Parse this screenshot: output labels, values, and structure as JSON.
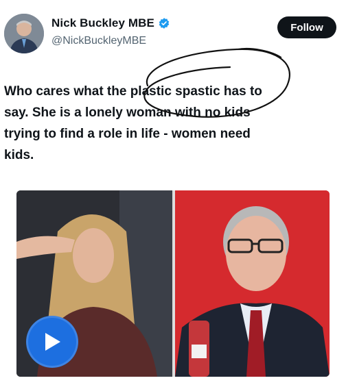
{
  "author": {
    "display_name": "Nick Buckley MBE",
    "handle": "@NickBuckleyMBE",
    "verified": true
  },
  "actions": {
    "follow_label": "Follow"
  },
  "tweet": {
    "lines": [
      "Who cares what the plastic spastic has to",
      "say. She is a lonely woman with no kids",
      "trying to find a role in life - women need",
      "kids."
    ]
  },
  "media": {
    "left_image": "woman-with-long-blonde-hair-photo",
    "right_image": "man-with-glasses-red-tie-photo",
    "has_video": true
  },
  "colors": {
    "follow_bg": "#0f1419",
    "verified_blue": "#1d9bf0",
    "play_blue": "#1d6fe0",
    "right_photo_bg": "#d8252c"
  }
}
